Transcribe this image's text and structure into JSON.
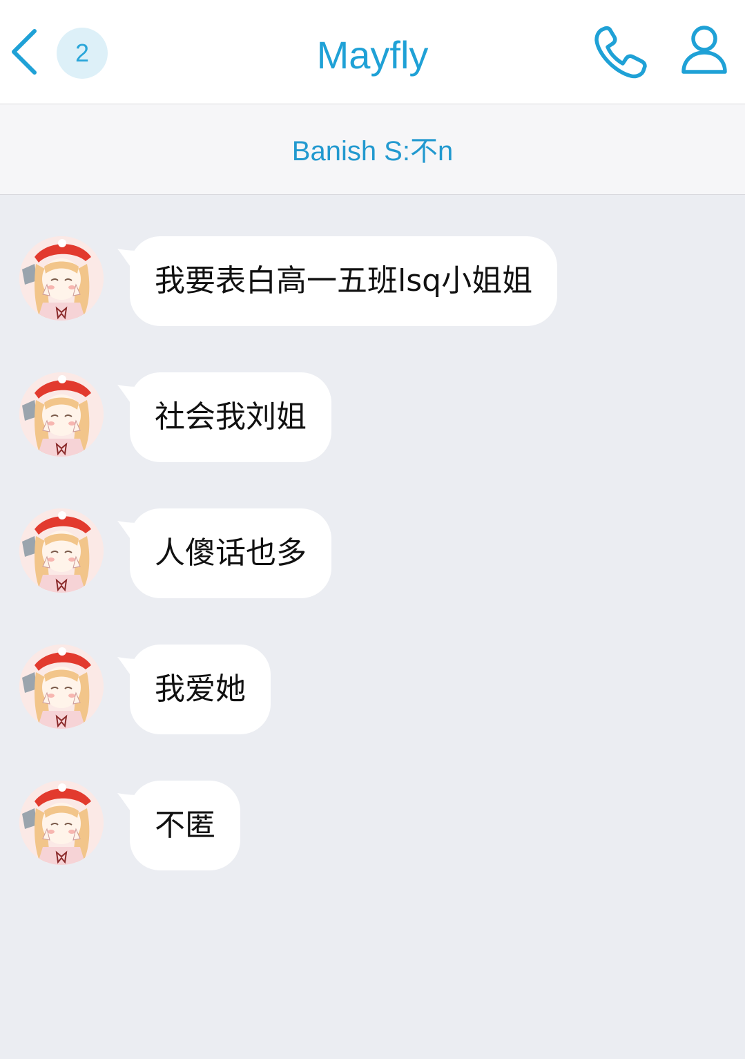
{
  "header": {
    "unread_count": "2",
    "title": "Mayfly"
  },
  "notice": {
    "text": "Banish S:不n"
  },
  "messages": [
    {
      "text": "我要表白高一五班lsq小姐姐"
    },
    {
      "text": "社会我刘姐"
    },
    {
      "text": "人傻话也多"
    },
    {
      "text": "我爱她"
    },
    {
      "text": "不匿"
    }
  ],
  "colors": {
    "accent": "#1fa1d6",
    "badge_bg": "#ddf0f8",
    "chat_bg": "#ebedf2",
    "bubble_bg": "#ffffff"
  },
  "icons": {
    "back": "chevron-left-icon",
    "call": "phone-icon",
    "profile": "person-icon"
  }
}
